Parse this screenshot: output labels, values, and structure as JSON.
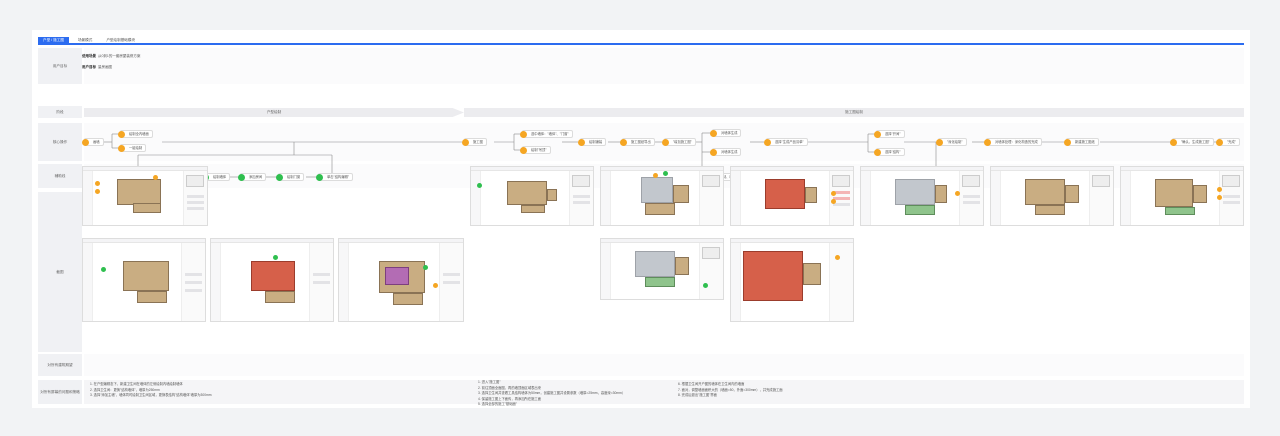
{
  "tabs": [
    {
      "label": "户型 / 施工图",
      "active": true
    },
    {
      "label": "场景模式",
      "active": false
    },
    {
      "label": "户型绘制基础模块",
      "active": false
    }
  ],
  "row_labels": {
    "user_goal": "用户目标",
    "stage": "阶段",
    "core_flow": "核心操作",
    "aux_flow": "辅助线",
    "screens": "截图",
    "expectation": "对所有建筑期望",
    "summary": "对所有屏幕的问题和策略"
  },
  "user_goal": {
    "scene_label": "使用场景",
    "scene_text": "从0到1的一套房屋装修方案",
    "goal_label": "用户目标",
    "goal_text": "量房画图"
  },
  "stages": {
    "left": "户型绘制",
    "right": "施工图绘制"
  },
  "nodes": {
    "n1": "画墙",
    "n2": "绘制全内墙面",
    "n3": "一键绘制",
    "n4": "施工图",
    "n5": "选中墙体：\"墙体\"、\"门窗\"",
    "n6": "绘制\"吊顶\"",
    "n7": "绘制铺装",
    "n8": "施工图纸导出",
    "n9": "\"增加施工图\"",
    "n10": "对墙体生成",
    "n11": "对墙体生成",
    "n12": "选择\"生成产品清单\"",
    "n13": "选择\"开间\"",
    "n14": "选择\"结构\"",
    "n15": "\"深化绘制\"",
    "n16": "对墙体处理：深化构造的完成",
    "n17": "新建施工图纸",
    "n18": "\"确认，生成施工图\"",
    "n19": "\"完成\"",
    "a1": "新建墙体：\"创建墙体\"",
    "a2": "绘制墙体",
    "a3": "添加房间",
    "a4": "绘制门窗",
    "a5": "单击\"结构编辑\"",
    "a6": "全面完善：绘制、精细绘制工具",
    "a7": "选择新建"
  },
  "notes_left": [
    "1. 在户型编辑态下，新建卫生间在墙体的左侧绘制内墙绘制墙体",
    "2. 选择卫生间：更换\"结构墙体\"，墙厚为250mm",
    "3. 选择\"添加主墙\"，墙体同时绘制卫生间区域，更换表结构\"结构墙体\"墙厚为300mm"
  ],
  "notes_mid": [
    "1. 进入\"施工图\"",
    "2. 前往顶面全面图，再的墙顶面区域表出来",
    "3. 选择卫生间并查看工具结构墙体为50mm，创建施工图并设置参数（墙厚=25mm，高度深=30mm）",
    "4. 保留施工图上下面传，再添加所在施工面",
    "5. 选择全部的施工\"基础面\""
  ],
  "notes_right": [
    "6. 根据卫生间开户图的墙体在卫生间内的墙面",
    "7. 面对，调整墙面面积大的（墙面=50，外面=300mm），并完成施工面",
    "8. 完成后退出\"施工图\"界面"
  ],
  "colors": {
    "accent": "#2c6cf0",
    "orange": "#f5a623",
    "green": "#2fbf4f"
  }
}
